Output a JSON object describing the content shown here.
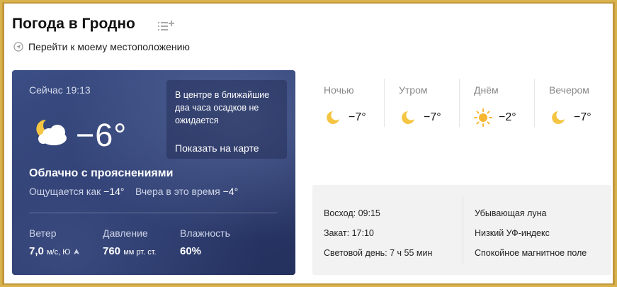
{
  "header": {
    "title": "Погода в Гродно",
    "locate_label": "Перейти к моему местоположению"
  },
  "now": {
    "time_label": "Сейчас 19:13",
    "temperature": "−6°",
    "condition": "Облачно с прояснениями",
    "feels_prefix": "Ощущается как ",
    "feels_value": "−14°",
    "yesterday_prefix": "Вчера в это время ",
    "yesterday_value": "−4°",
    "icon": "partly-cloudy-night-icon",
    "precip_text": "В центре в ближайшие два часа осадков не ожидается",
    "map_link": "Показать на карте",
    "wind": {
      "label": "Ветер",
      "value": "7,0",
      "unit": "м/с, Ю"
    },
    "pressure": {
      "label": "Давление",
      "value": "760",
      "unit": "мм рт. ст."
    },
    "humidity": {
      "label": "Влажность",
      "value": "60%"
    }
  },
  "day_parts": [
    {
      "name": "Ночью",
      "temp": "−7°",
      "icon": "moon-icon"
    },
    {
      "name": "Утром",
      "temp": "−7°",
      "icon": "moon-icon"
    },
    {
      "name": "Днём",
      "temp": "−2°",
      "icon": "sun-icon"
    },
    {
      "name": "Вечером",
      "temp": "−7°",
      "icon": "moon-icon"
    }
  ],
  "astro": {
    "sunrise": "Восход: 09:15",
    "sunset": "Закат: 17:10",
    "daylight": "Световой день: 7 ч 55 мин",
    "moon": "Убывающая луна",
    "uv": "Низкий УФ-индекс",
    "magnetic": "Спокойное магнитное поле"
  },
  "colors": {
    "card_bg": "#2b3a6d",
    "moon": "#f5c542",
    "sun": "#f7b733"
  }
}
